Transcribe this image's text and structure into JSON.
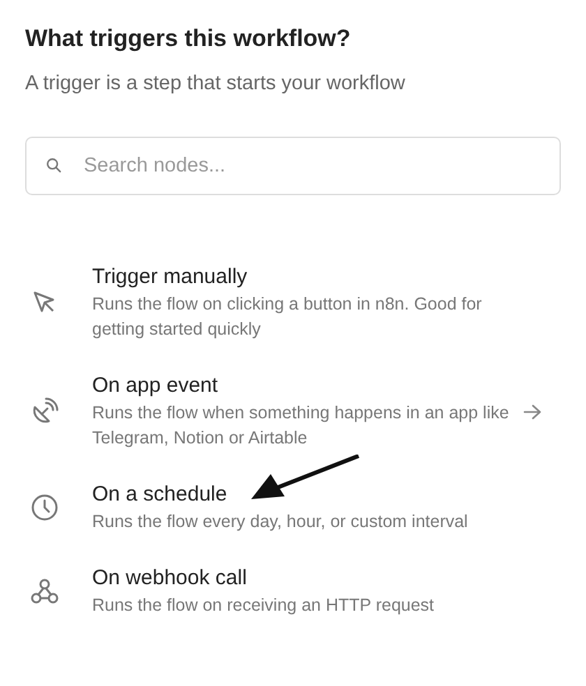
{
  "heading": "What triggers this workflow?",
  "subheading": "A trigger is a step that starts your workflow",
  "search": {
    "placeholder": "Search nodes..."
  },
  "items": [
    {
      "kind": "manual",
      "title": "Trigger manually",
      "description": "Runs the flow on clicking a button in n8n. Good for getting started quickly",
      "has_arrow": false,
      "annotated": false
    },
    {
      "kind": "app",
      "title": "On app event",
      "description": "Runs the flow when something happens in an app like Telegram, Notion or Airtable",
      "has_arrow": true,
      "annotated": false
    },
    {
      "kind": "schedule",
      "title": "On a schedule",
      "description": "Runs the flow every day, hour, or custom interval",
      "has_arrow": false,
      "annotated": true
    },
    {
      "kind": "webhook",
      "title": "On webhook call",
      "description": "Runs the flow on receiving an HTTP request",
      "has_arrow": false,
      "annotated": false
    }
  ]
}
